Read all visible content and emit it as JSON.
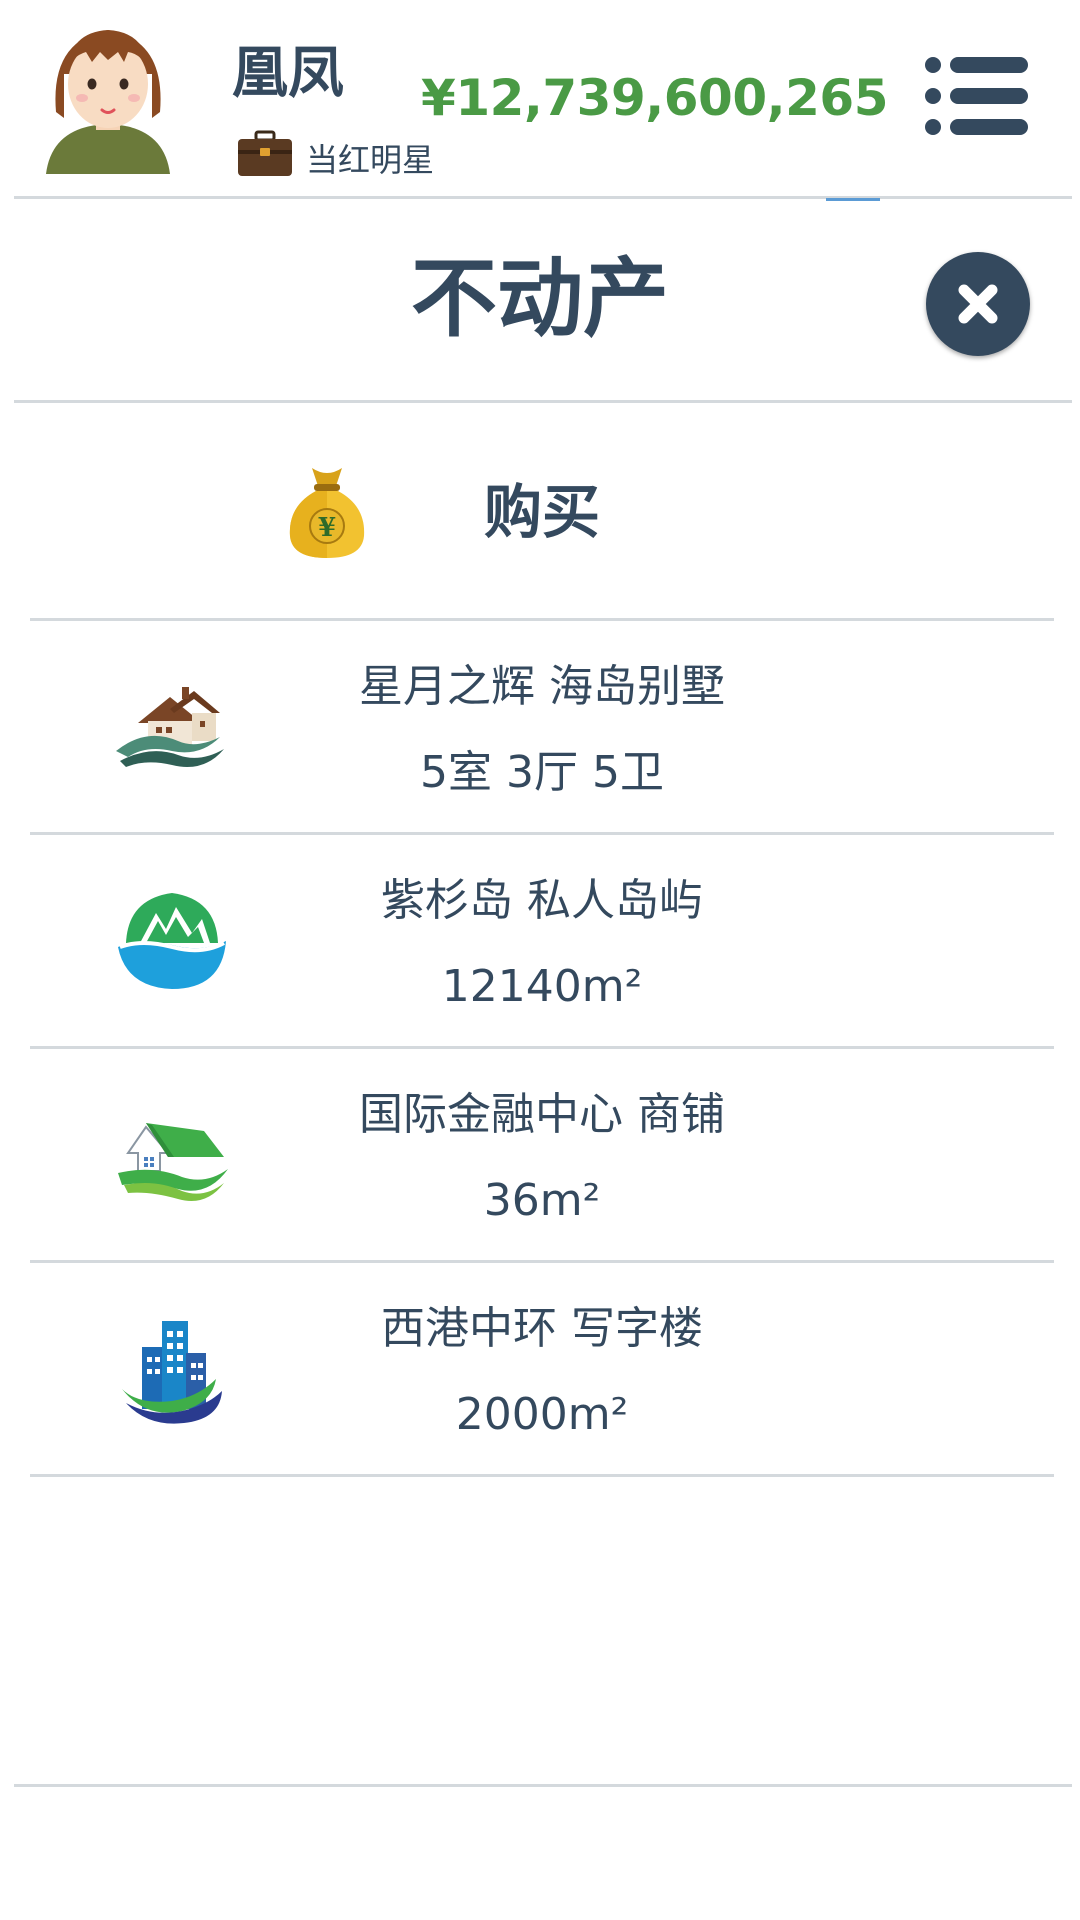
{
  "player": {
    "name": "凰凤",
    "job": "当红明星",
    "money": "¥12,739,600,265"
  },
  "colors": {
    "text": "#34495e",
    "money": "#4a9a45",
    "divider": "#d4d9dd",
    "close_button": "#34495e"
  },
  "icons": {
    "avatar": "girl-avatar",
    "job": "briefcase-icon",
    "menu": "menu-list-icon",
    "close": "close-icon",
    "buy": "money-bag-icon"
  },
  "panel": {
    "title": "不动产",
    "buy_label": "购买"
  },
  "properties": [
    {
      "name": "星月之辉 海岛别墅",
      "detail": "5室 3厅 5卫",
      "icon": "villa-icon"
    },
    {
      "name": "紫杉岛 私人岛屿",
      "detail": "12140m²",
      "icon": "island-icon"
    },
    {
      "name": "国际金融中心 商铺",
      "detail": "36m²",
      "icon": "shop-icon"
    },
    {
      "name": "西港中环 写字楼",
      "detail": "2000m²",
      "icon": "office-building-icon"
    }
  ]
}
